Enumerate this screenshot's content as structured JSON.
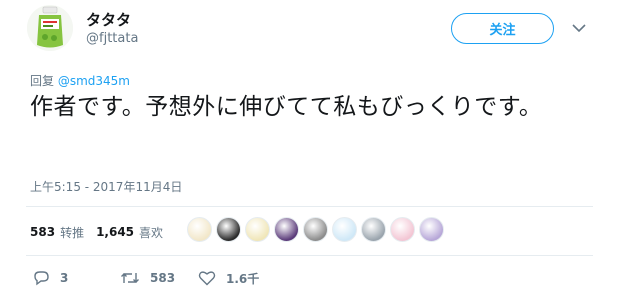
{
  "profile": {
    "display_name": "タタタ",
    "handle": "@fjttata",
    "avatar_icon": "green-drink-bottle-avatar"
  },
  "header": {
    "follow_label": "关注",
    "menu_icon": "chevron-down-icon"
  },
  "tweet": {
    "reply_prefix": "回复",
    "reply_mention": "@smd345m",
    "text": "作者です。予想外に伸びてて私もびっくりです。",
    "timestamp": "上午5:15 - 2017年11月4日"
  },
  "stats": {
    "retweets_count": "583",
    "retweets_label": "转推",
    "likes_count": "1,645",
    "likes_label": "喜欢"
  },
  "liker_avatars": [
    {
      "name": "liker-avatar-1",
      "color": "#f2e7c9"
    },
    {
      "name": "liker-avatar-2",
      "color": "#2b2b2b"
    },
    {
      "name": "liker-avatar-3",
      "color": "#f0e6b8"
    },
    {
      "name": "liker-avatar-4",
      "color": "#5b3b7a"
    },
    {
      "name": "liker-avatar-5",
      "color": "#8c8c8c"
    },
    {
      "name": "liker-avatar-6",
      "color": "#cfe8f7"
    },
    {
      "name": "liker-avatar-7",
      "color": "#9aa4ad"
    },
    {
      "name": "liker-avatar-8",
      "color": "#f3c6d4"
    },
    {
      "name": "liker-avatar-9",
      "color": "#b7a7d8"
    }
  ],
  "actions": {
    "reply_count": "3",
    "retweet_count": "583",
    "like_count": "1.6千"
  },
  "colors": {
    "accent": "#1da1f2",
    "secondary_text": "#657786",
    "divider": "#e6ecf0"
  }
}
